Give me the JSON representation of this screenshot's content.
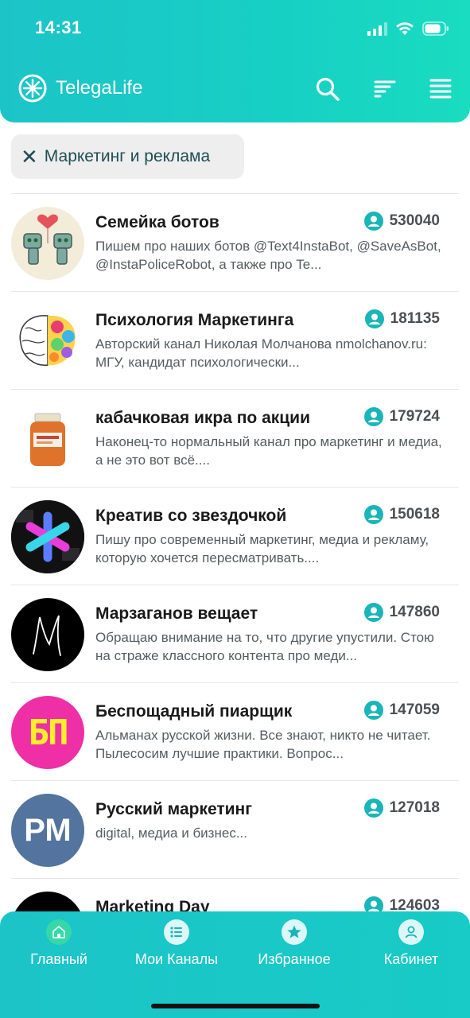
{
  "status_bar": {
    "time": "14:31"
  },
  "header": {
    "app_name": "TelegaLife",
    "accent": "#1cc4c8"
  },
  "filter": {
    "label": "Маркетинг и реклама"
  },
  "channels": [
    {
      "title": "Семейка ботов",
      "subscribers": "530040",
      "description": "Пишем про наших ботов @Text4InstaBot, @SaveAsBot, @InstaPoliceRobot, а также про Te..."
    },
    {
      "title": "Психология Маркетинга",
      "subscribers": "181135",
      "description": "Авторский канал Николая Молчанова nmolchanov.ru: МГУ, кандидат психологически..."
    },
    {
      "title": "кабачковая икра по акции",
      "subscribers": "179724",
      "description": "Наконец-то нормальный канал про маркетинг и медиа, а не это вот всё...."
    },
    {
      "title": "Креатив со звездочкой",
      "subscribers": "150618",
      "description": "Пишу про современный маркетинг, медиа и рекламу, которую хочется пересматривать...."
    },
    {
      "title": "Марзаганов вещает",
      "subscribers": "147860",
      "description": "Обращаю внимание на то, что другие упустили. Стою на страже классного контента про меди..."
    },
    {
      "title": "Беспощадный пиарщик",
      "subscribers": "147059",
      "description": "Альманах русской жизни. Все знают, никто не читает. Пылесосим лучшие практики. Вопрос..."
    },
    {
      "title": "Русский маркетинг",
      "subscribers": "127018",
      "description": "digital, медиа и бизнес..."
    },
    {
      "title": "Marketing Day",
      "subscribers": "124603",
      "description": ""
    }
  ],
  "avatar_text": {
    "bp": "БП",
    "rm": "РМ"
  },
  "bottom_nav": [
    {
      "label": "Главный",
      "icon": "home-icon"
    },
    {
      "label": "Мои Каналы",
      "icon": "list-icon"
    },
    {
      "label": "Избранное",
      "icon": "star-icon"
    },
    {
      "label": "Кабинет",
      "icon": "user-icon"
    }
  ]
}
